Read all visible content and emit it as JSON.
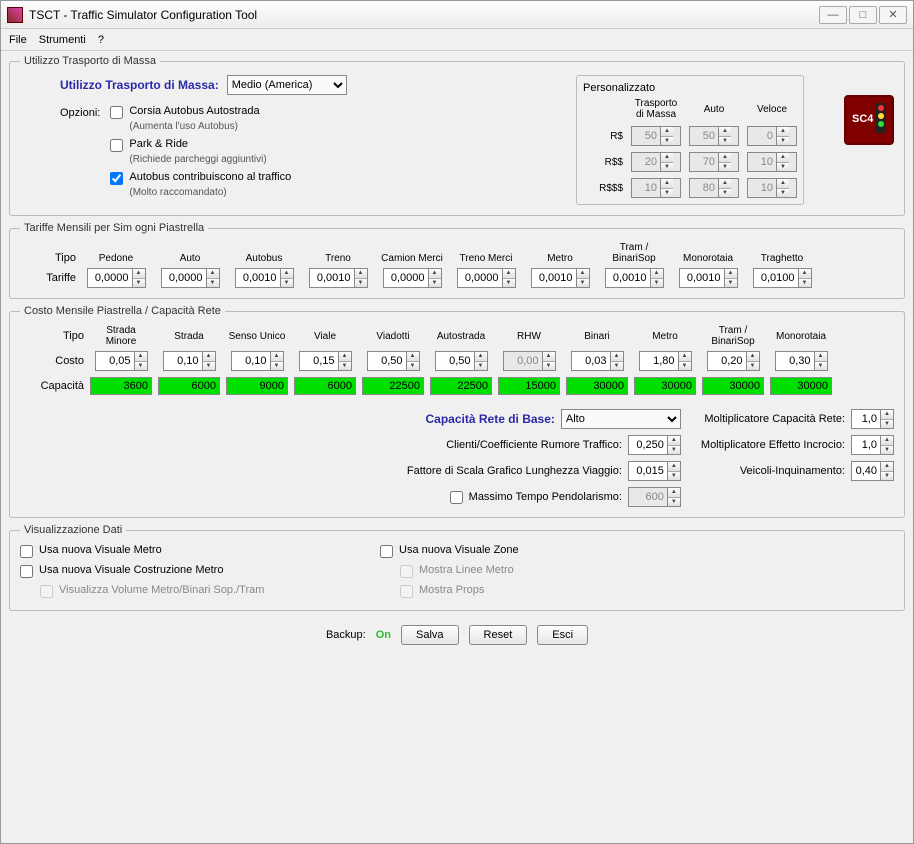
{
  "window": {
    "title": "TSCT - Traffic Simulator Configuration Tool"
  },
  "menu": {
    "file": "File",
    "tools": "Strumenti",
    "help": "?"
  },
  "massTransit": {
    "legend": "Utilizzo Trasporto di Massa",
    "headerLabel": "Utilizzo Trasporto di Massa:",
    "selected": "Medio (America)",
    "optionsLabel": "Opzioni:",
    "opt1": "Corsia Autobus Autostrada",
    "opt1sub": "(Aumenta l'uso Autobus)",
    "opt2": "Park & Ride",
    "opt2sub": "(Richiede parcheggi aggiuntivi)",
    "opt3": "Autobus contribuiscono al traffico",
    "opt3sub": "(Molto raccomandato)",
    "customTitle": "Personalizzato",
    "cols": {
      "mt": "Trasporto di Massa",
      "auto": "Auto",
      "speed": "Veloce"
    },
    "rows": [
      "R$",
      "R$$",
      "R$$$"
    ],
    "vals": [
      [
        "50",
        "50",
        "0"
      ],
      [
        "20",
        "70",
        "10"
      ],
      [
        "10",
        "80",
        "10"
      ]
    ]
  },
  "fares": {
    "legend": "Tariffe Mensili per Sim ogni Piastrella",
    "typeLabel": "Tipo",
    "rowLabel": "Tariffe",
    "cols": [
      "Pedone",
      "Auto",
      "Autobus",
      "Treno",
      "Camion Merci",
      "Treno Merci",
      "Metro",
      "Tram / BinariSop",
      "Monorotaia",
      "Traghetto"
    ],
    "vals": [
      "0,0000",
      "0,0000",
      "0,0010",
      "0,0010",
      "0,0000",
      "0,0000",
      "0,0010",
      "0,0010",
      "0,0010",
      "0,0100"
    ]
  },
  "cost": {
    "legend": "Costo Mensile Piastrella / Capacità Rete",
    "typeLabel": "Tipo",
    "costLabel": "Costo",
    "capLabel": "Capacità",
    "cols": [
      "Strada Minore",
      "Strada",
      "Senso Unico",
      "Viale",
      "Viadotti",
      "Autostrada",
      "RHW",
      "Binari",
      "Metro",
      "Tram / BinariSop",
      "Monorotaia"
    ],
    "costVals": [
      "0,05",
      "0,10",
      "0,10",
      "0,15",
      "0,50",
      "0,50",
      "0,00",
      "0,03",
      "1,80",
      "0,20",
      "0,30"
    ],
    "capVals": [
      "3600",
      "6000",
      "9000",
      "6000",
      "22500",
      "22500",
      "15000",
      "30000",
      "30000",
      "30000",
      "30000"
    ],
    "baseCapLabel": "Capacità Rete di Base:",
    "baseCapVal": "Alto",
    "custNoise": "Clienti/Coefficiente Rumore Traffico:",
    "custNoiseV": "0,250",
    "tripScale": "Fattore di Scala Grafico Lunghezza Viaggio:",
    "tripScaleV": "0,015",
    "maxCommute": "Massimo Tempo Pendolarismo:",
    "maxCommuteV": "600",
    "multCap": "Moltiplicatore Capacità Rete:",
    "multCapV": "1,0",
    "multInt": "Moltiplicatore Effetto Incrocio:",
    "multIntV": "1,0",
    "vehPoll": "Veicoli-Inquinamento:",
    "vehPollV": "0,40"
  },
  "dataView": {
    "legend": "Visualizzazione Dati",
    "metroView": "Usa nuova Visuale Metro",
    "metroBuild": "Usa nuova Visuale Costruzione Metro",
    "metroVol": "Visualizza Volume Metro/Binari Sop./Tram",
    "zoneView": "Usa nuova Visuale Zone",
    "showLines": "Mostra Linee Metro",
    "showProps": "Mostra Props"
  },
  "footer": {
    "backup": "Backup:",
    "on": "On",
    "save": "Salva",
    "reset": "Reset",
    "exit": "Esci"
  }
}
